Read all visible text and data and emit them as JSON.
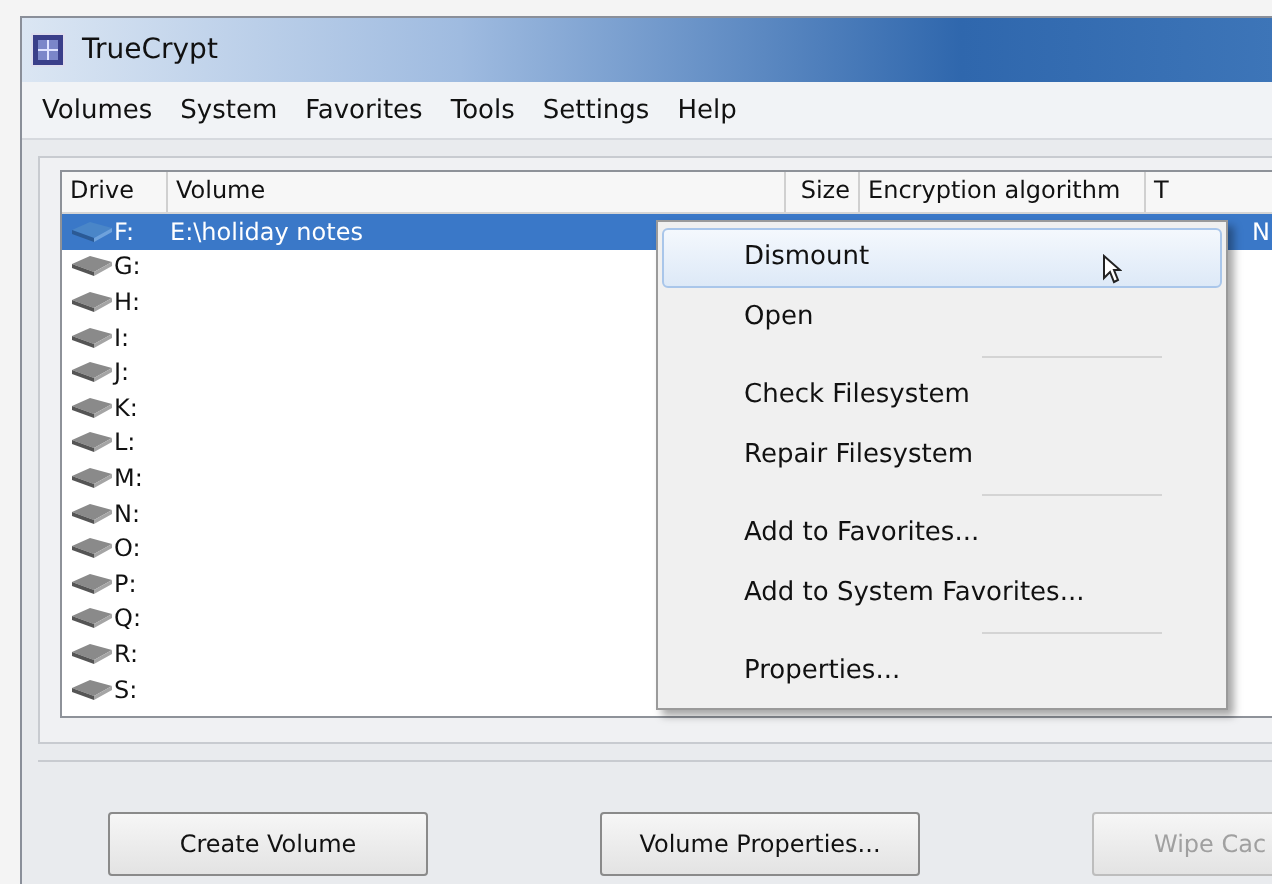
{
  "window": {
    "title": "TrueCrypt"
  },
  "menu_bar": [
    "Volumes",
    "System",
    "Favorites",
    "Tools",
    "Settings",
    "Help"
  ],
  "table": {
    "columns": [
      "Drive",
      "Volume",
      "Size",
      "Encryption algorithm",
      "T"
    ],
    "rows": [
      {
        "drive": "F:",
        "volume": "E:\\holiday notes",
        "column_5": "N",
        "selected": true,
        "mounted": true
      },
      {
        "drive": "G:",
        "selected": false,
        "mounted": false
      },
      {
        "drive": "H:",
        "selected": false,
        "mounted": false
      },
      {
        "drive": "I:",
        "selected": false,
        "mounted": false
      },
      {
        "drive": "J:",
        "selected": false,
        "mounted": false
      },
      {
        "drive": "K:",
        "selected": false,
        "mounted": false
      },
      {
        "drive": "L:",
        "selected": false,
        "mounted": false
      },
      {
        "drive": "M:",
        "selected": false,
        "mounted": false
      },
      {
        "drive": "N:",
        "selected": false,
        "mounted": false
      },
      {
        "drive": "O:",
        "selected": false,
        "mounted": false
      },
      {
        "drive": "P:",
        "selected": false,
        "mounted": false
      },
      {
        "drive": "Q:",
        "selected": false,
        "mounted": false
      },
      {
        "drive": "R:",
        "selected": false,
        "mounted": false
      },
      {
        "drive": "S:",
        "selected": false,
        "mounted": false
      }
    ]
  },
  "context_menu": {
    "groups": [
      [
        {
          "label": "Dismount",
          "selected": true
        },
        {
          "label": "Open",
          "selected": false
        }
      ],
      [
        {
          "label": "Check Filesystem",
          "selected": false
        },
        {
          "label": "Repair Filesystem",
          "selected": false
        }
      ],
      [
        {
          "label": "Add to Favorites...",
          "selected": false
        },
        {
          "label": "Add to System Favorites...",
          "selected": false
        }
      ],
      [
        {
          "label": "Properties...",
          "selected": false
        }
      ]
    ]
  },
  "buttons": [
    {
      "label": "Create Volume",
      "disabled": false
    },
    {
      "label": "Volume Properties...",
      "disabled": false
    },
    {
      "label": "Wipe Cac",
      "disabled": true
    }
  ]
}
